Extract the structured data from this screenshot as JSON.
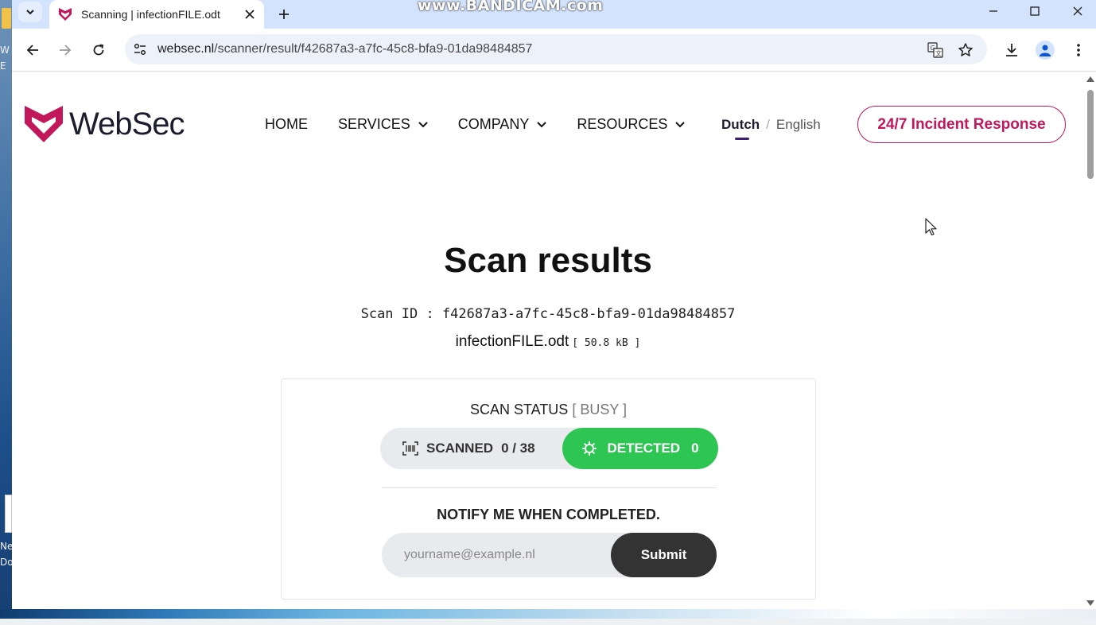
{
  "desktop": {
    "left_labels": [
      "W",
      "E",
      "Ne",
      "Do"
    ]
  },
  "browser": {
    "tab_title": "Scanning | infectionFILE.odt",
    "watermark": "www.BANDICAM.com",
    "url_host": "websec.nl",
    "url_path": "/scanner/result/f42687a3-a7fc-45c8-bfa9-01da98484857"
  },
  "site": {
    "logo_text": "WebSec",
    "brand_color": "#c2185b",
    "nav": [
      {
        "label": "HOME",
        "has_menu": false
      },
      {
        "label": "SERVICES",
        "has_menu": true
      },
      {
        "label": "COMPANY",
        "has_menu": true
      },
      {
        "label": "RESOURCES",
        "has_menu": true
      }
    ],
    "lang_active": "Dutch",
    "lang_separator": "/",
    "lang_other": "English",
    "incident_button": "24/7 Incident Response"
  },
  "scan": {
    "title": "Scan results",
    "scan_id_text": "Scan ID : f42687a3-a7fc-45c8-bfa9-01da98484857",
    "file_name": "infectionFILE.odt",
    "file_size": "[ 50.8 kB ]",
    "status_label": "SCAN STATUS",
    "status_value": "[ BUSY ]",
    "scanned_label": "SCANNED",
    "scanned_value": "0 / 38",
    "detected_label": "DETECTED",
    "detected_value": "0",
    "detected_color": "#2dc653",
    "notify_label": "NOTIFY ME WHEN COMPLETED.",
    "email_placeholder": "yourname@example.nl",
    "submit_label": "Submit"
  }
}
